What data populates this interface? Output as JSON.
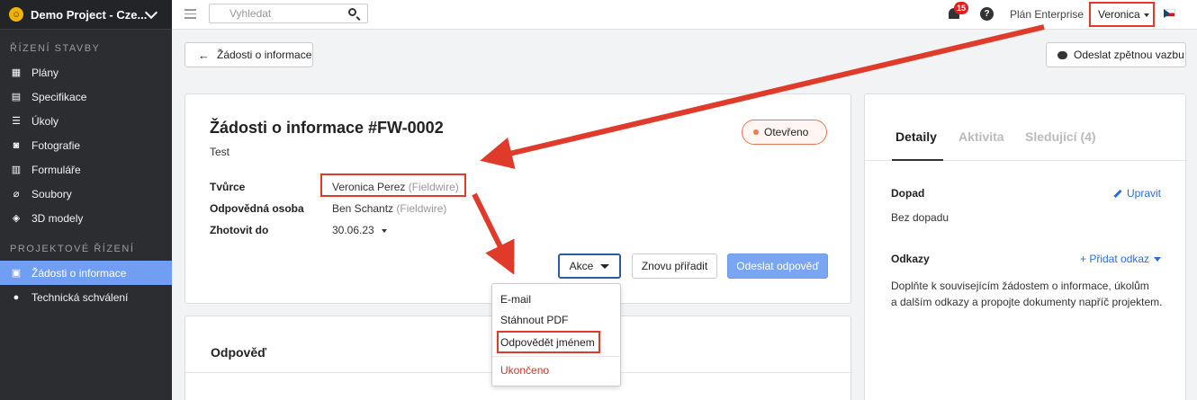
{
  "sidebar": {
    "project_name": "Demo Project - Cze...",
    "section1": "ŘÍZENÍ STAVBY",
    "section2": "PROJEKTOVÉ ŘÍZENÍ",
    "items1": [
      {
        "label": "Plány",
        "icon": "plans-icon"
      },
      {
        "label": "Specifikace",
        "icon": "specifications-icon"
      },
      {
        "label": "Úkoly",
        "icon": "tasks-icon"
      },
      {
        "label": "Fotografie",
        "icon": "camera-icon"
      },
      {
        "label": "Formuláře",
        "icon": "clipboard-icon"
      },
      {
        "label": "Soubory",
        "icon": "paperclip-icon"
      },
      {
        "label": "3D modely",
        "icon": "cube-icon"
      }
    ],
    "items2": [
      {
        "label": "Žádosti o informace",
        "icon": "document-icon",
        "active": true
      },
      {
        "label": "Technická schválení",
        "icon": "person-icon"
      }
    ]
  },
  "topbar": {
    "search_placeholder": "Vyhledat",
    "notifications_count": "15",
    "help_label": "?",
    "plan_label": "Plán Enterprise",
    "user_name": "Veronica"
  },
  "header": {
    "back_label": "Žádosti o informace",
    "feedback_label": "Odeslat zpětnou vazbu"
  },
  "rfi": {
    "title": "Žádosti o informace #FW-0002",
    "subtitle": "Test",
    "status": "Otevřeno",
    "fields": {
      "creator_label": "Tvůrce",
      "creator_name": "Veronica Perez",
      "creator_org": "(Fieldwire)",
      "assignee_label": "Odpovědná osoba",
      "assignee_name": "Ben Schantz",
      "assignee_org": "(Fieldwire)",
      "due_label": "Zhotovit do",
      "due_value": "30.06.23"
    },
    "actions": {
      "akce": "Akce",
      "reassign": "Znovu přiřadit",
      "send_answer": "Odeslat odpověď"
    },
    "menu": {
      "email": "E-mail",
      "pdf": "Stáhnout PDF",
      "answer_as": "Odpovědět jménem",
      "close": "Ukončeno"
    }
  },
  "answer": {
    "heading": "Odpověď"
  },
  "right": {
    "tabs": [
      "Detaily",
      "Aktivita",
      "Sledující (4)"
    ],
    "impact_label": "Dopad",
    "edit_label": "Upravit",
    "impact_value": "Bez dopadu",
    "links_label": "Odkazy",
    "add_link_label": "+ Přidat odkaz",
    "links_help_line1": "Doplňte k souvisejícím žádostem o informace, úkolům",
    "links_help_line2": "a dalším odkazy a propojte dokumenty napříč projektem."
  },
  "colors": {
    "accent_blue": "#6f9ef3",
    "highlight_red": "#e03a2a",
    "status_orange": "#ef7b53"
  }
}
